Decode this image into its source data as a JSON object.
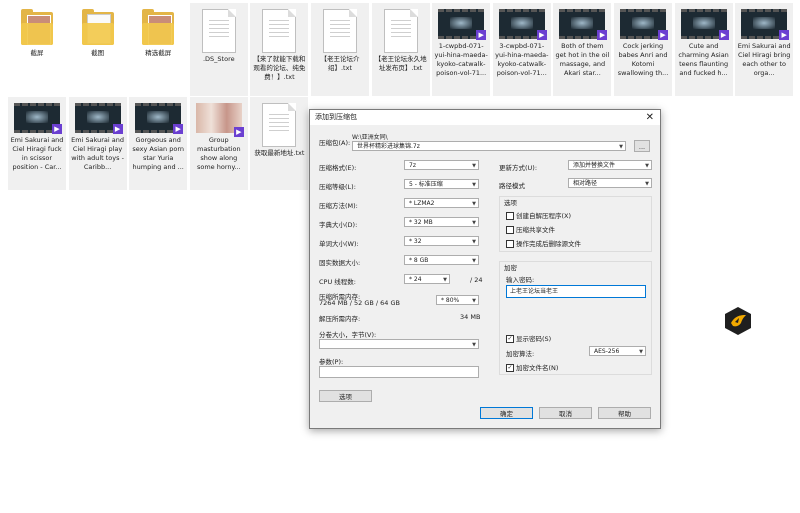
{
  "files_row1": [
    {
      "type": "folder-pic",
      "label": "截屏"
    },
    {
      "type": "folder-paper",
      "label": "截图"
    },
    {
      "type": "folder-pic",
      "label": "精选截屏"
    },
    {
      "type": "doc",
      "label": ".DS_Store"
    },
    {
      "type": "doc",
      "label": "【来了就能下载和观看的论坛、纯免费！】.txt"
    },
    {
      "type": "doc",
      "label": "【老王论坛介绍】.txt"
    },
    {
      "type": "doc",
      "label": "【老王论坛永久地址发布页】.txt"
    },
    {
      "type": "video",
      "label": "1-cwpbd-071-yui-hina-maeda-kyoko-catwalk-poison-vol-71..."
    },
    {
      "type": "video",
      "label": "3-cwpbd-071-yui-hina-maeda-kyoko-catwalk-poison-vol-71..."
    },
    {
      "type": "video",
      "label": "Both of them get hot in the oil massage, and Akari star..."
    },
    {
      "type": "video",
      "label": "Cock jerking babes Anri and Kotomi swallowing th..."
    },
    {
      "type": "video",
      "label": "Cute and charming Asian teens flaunting and fucked h..."
    },
    {
      "type": "video",
      "label": "Emi Sakurai and Ciel Hiragi bring each other to orga..."
    }
  ],
  "files_row2": [
    {
      "type": "video",
      "label": "Emi Sakurai and Ciel Hiragi fuck in scissor position - Car..."
    },
    {
      "type": "video",
      "label": "Emi Sakurai and Ciel Hiragi play with adult toys - Caribb..."
    },
    {
      "type": "video",
      "label": "Gorgeous and sexy Asian porn star Yuria humping and ..."
    },
    {
      "type": "photo",
      "label": "Group masturbation show along some horny..."
    },
    {
      "type": "doc",
      "label": "获取最新地址.txt"
    }
  ],
  "dialog": {
    "title": "添加到压缩包",
    "close": "✕",
    "archive_label": "压缩包(A):",
    "archive_path": "W:\\亚洲女同\\",
    "archive_name": "世界杯精彩进球集锦.7z",
    "browse": "...",
    "format_label": "压缩格式(E):",
    "format_value": "7z",
    "level_label": "压缩等级(L):",
    "level_value": "5 - 标准压缩",
    "method_label": "压缩方法(M):",
    "method_value": "* LZMA2",
    "dict_label": "字典大小(D):",
    "dict_value": "* 32 MB",
    "word_label": "单词大小(W):",
    "word_value": "* 32",
    "solid_label": "固实数据大小:",
    "solid_value": "* 8 GB",
    "cpu_label": "CPU 线程数:",
    "cpu_value": "* 24",
    "cpu_total": "/ 24",
    "mem_label": "压缩所需内存:",
    "mem_detail": "7264 MB / 52 GB / 64 GB",
    "mem_pct": "* 80%",
    "decomp_label": "解压所需内存:",
    "decomp_value": "34 MB",
    "split_label": "分卷大小，字节(V):",
    "params_label": "参数(P):",
    "options_btn": "选项",
    "update_label": "更新方式(U):",
    "update_value": "添加并替换文件",
    "path_label": "路径模式",
    "path_value": "相对路径",
    "options_group": "选项",
    "opt_sfx": "创建自解压程序(X)",
    "opt_shared": "压缩共享文件",
    "opt_delete": "操作完成后删除源文件",
    "encrypt_group": "加密",
    "pwd_label": "输入密码:",
    "pwd_value": "上老王论坛当老王",
    "show_pwd": "显示密码(S)",
    "enc_method_label": "加密算法:",
    "enc_method_value": "AES-256",
    "enc_names": "加密文件名(N)",
    "ok": "确定",
    "cancel": "取消",
    "help": "帮助"
  }
}
